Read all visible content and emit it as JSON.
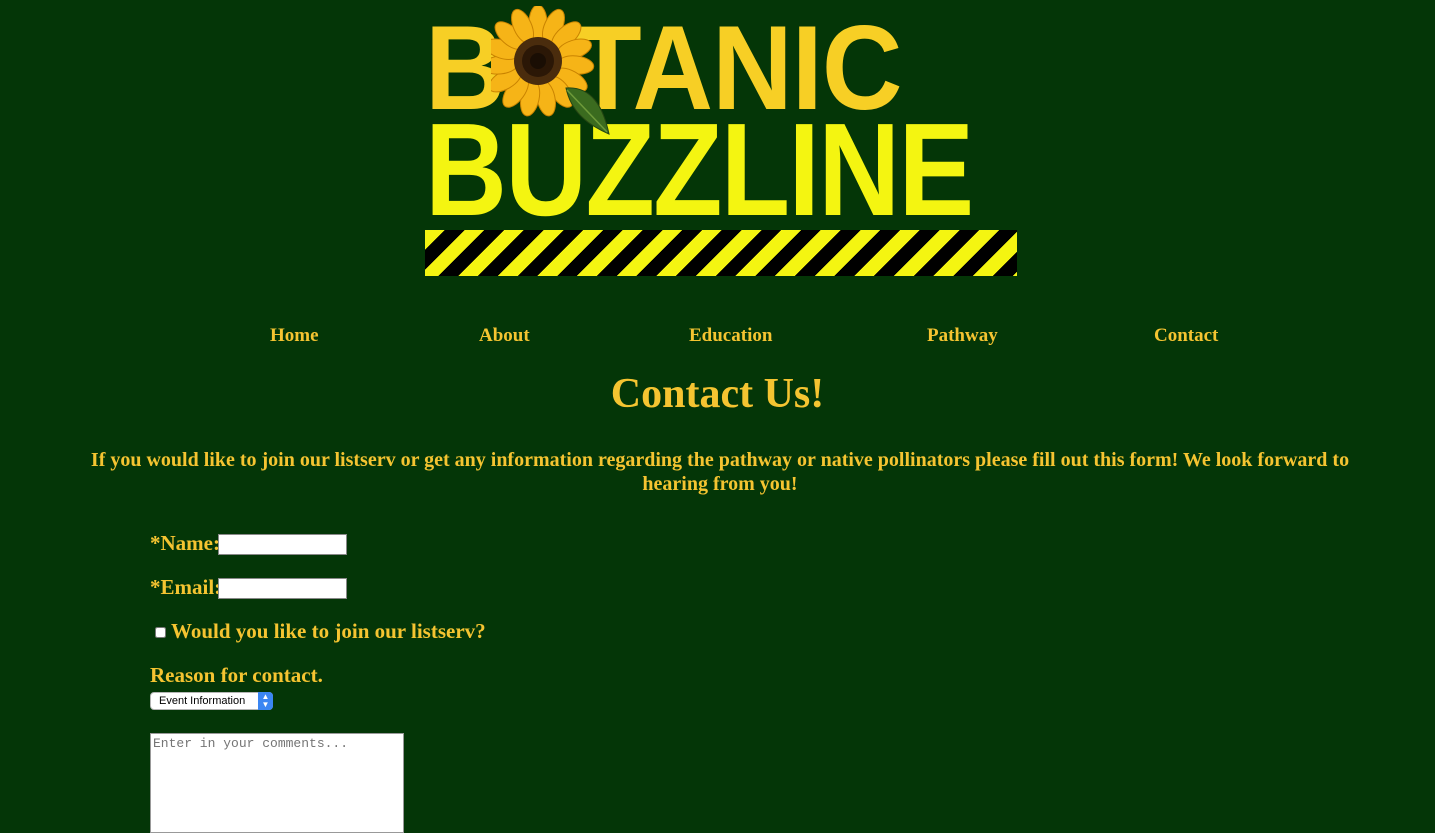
{
  "logo": {
    "line1_a": "B",
    "line1_b": "TANIC",
    "line2": "BUZZLINE"
  },
  "nav": {
    "home": "Home",
    "about": "About",
    "education": "Education",
    "pathway": "Pathway",
    "contact": "Contact"
  },
  "main": {
    "title": "Contact Us!",
    "intro": "If you would like to join our listserv or get any information regarding the pathway or native pollinators please fill out this form! We look forward to hearing from you!"
  },
  "form": {
    "name_label": "*Name:",
    "name_value": "",
    "email_label": "*Email:",
    "email_value": "",
    "listserv_label": "Would you like to join our listserv?",
    "reason_label": "Reason for contact.",
    "reason_selected": "Event Information",
    "comments_placeholder": "Enter in your comments..."
  },
  "colors": {
    "background": "#043607",
    "text": "#f5c431",
    "logo_yellow": "#f4f511",
    "logo_gold": "#f7cf25"
  }
}
